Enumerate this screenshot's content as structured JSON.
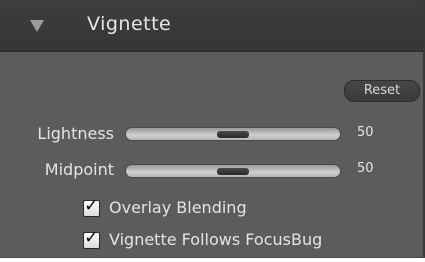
{
  "panel": {
    "title": "Vignette",
    "reset_label": "Reset"
  },
  "sliders": [
    {
      "label": "Lightness",
      "value": "50",
      "level": 0.5
    },
    {
      "label": "Midpoint",
      "value": "50",
      "level": 0.5
    }
  ],
  "checkboxes": [
    {
      "label": "Overlay Blending",
      "checked": true
    },
    {
      "label": "Vignette Follows FocusBug",
      "checked": true
    }
  ],
  "icons": {
    "disclosure": "triangle-down-icon",
    "check": "checkmark-icon"
  }
}
